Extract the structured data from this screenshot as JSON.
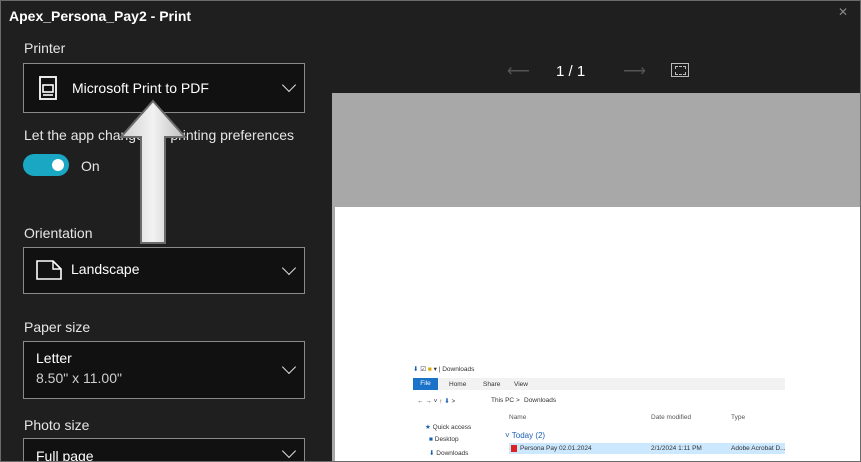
{
  "window": {
    "title": "Apex_Persona_Pay2 - Print"
  },
  "printer": {
    "label": "Printer",
    "value": "Microsoft Print to PDF"
  },
  "preferences": {
    "label": "Let the app change my printing preferences",
    "toggle_state": "On"
  },
  "orientation": {
    "label": "Orientation",
    "value": "Landscape"
  },
  "paper_size": {
    "label": "Paper size",
    "value": "Letter",
    "dimensions": "8.50\" x 11.00\""
  },
  "photo_size": {
    "label": "Photo size",
    "value": "Full page"
  },
  "preview": {
    "page_counter": "1 / 1",
    "explorer": {
      "address_title": "Downloads",
      "tabs": [
        "File",
        "Home",
        "Share",
        "View"
      ],
      "breadcrumb": [
        "This PC",
        "Downloads"
      ],
      "columns": [
        "Name",
        "Date modified",
        "Type"
      ],
      "nav_items": [
        "Quick access",
        "Desktop",
        "Downloads"
      ],
      "group": "Today (2)",
      "file": {
        "name": "Persona Pay 02.01.2024",
        "date": "2/1/2024 1:11 PM",
        "type": "Adobe Acrobat D..."
      }
    }
  },
  "colors": {
    "toggle_on": "#1aa7c4",
    "background": "#1f1f1f",
    "preview_gray": "#a8a8a8"
  }
}
